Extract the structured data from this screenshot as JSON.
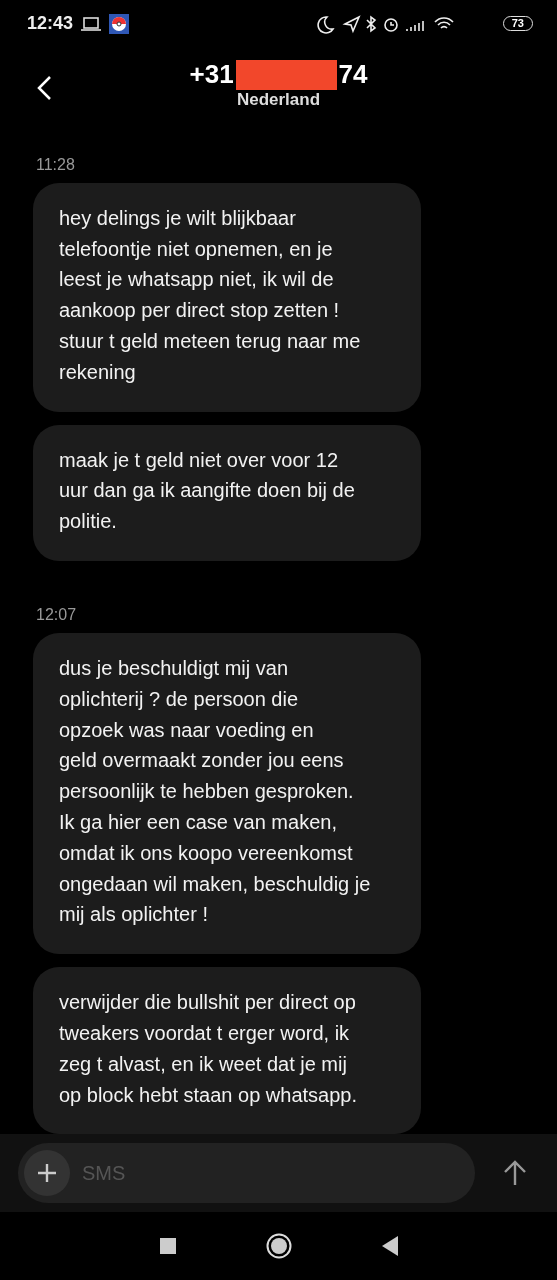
{
  "status_bar": {
    "time": "12:43",
    "battery": "73"
  },
  "header": {
    "number_start": "+31",
    "number_end": "74",
    "subtitle": "Nederland"
  },
  "groups": [
    {
      "time": "11:28",
      "messages": [
        "hey delings je wilt blijkbaar\ntelefoontje niet opnemen, en je\nleest je whatsapp niet, ik wil de\naankoop per direct stop zetten !\nstuur t geld meteen terug naar me\nrekening",
        "maak je t geld niet over voor 12\nuur dan ga ik aangifte doen bij de\npolitie."
      ]
    },
    {
      "time": "12:07",
      "messages": [
        "dus je beschuldigt mij van\noplichterij ? de persoon die\nopzoek was naar voeding en\ngeld overmaakt zonder jou eens\npersoonlijk te hebben gesproken.\nIk ga hier een case van maken,\nomdat ik ons koopo vereenkomst\nongedaan wil maken, beschuldig je\nmij als oplichter !",
        "verwijder die bullshit per direct op\ntweakers voordat t erger word, ik\nzeg t alvast, en ik weet dat je mij\nop block hebt staan op whatsapp."
      ]
    }
  ],
  "composer": {
    "placeholder": "SMS"
  }
}
